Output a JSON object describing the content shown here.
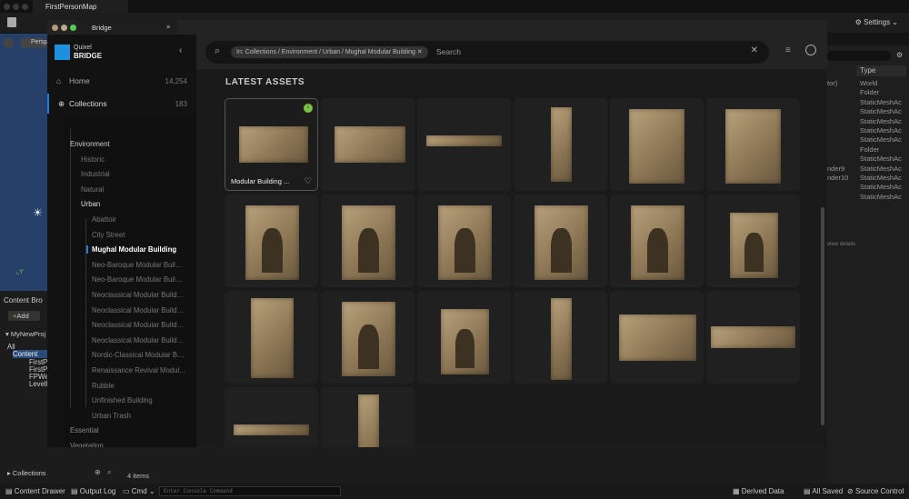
{
  "app": {
    "tab_title": "FirstPersonMap",
    "settings_label": "Settings",
    "viewport_label": "Persp"
  },
  "content_browser": {
    "title": "Content Bro",
    "add_label": "Add",
    "project": "MyNewProj",
    "tree": [
      "All",
      "Content",
      "FirstP",
      "FirstP",
      "FPWe",
      "LevelI"
    ],
    "collections_label": "Collections",
    "items_count": "4 items"
  },
  "statusbar": {
    "content_drawer": "Content Drawer",
    "output_log": "Output Log",
    "cmd": "Cmd",
    "console_placeholder": "Enter Console Command",
    "derived_data": "Derived Data",
    "all_saved": "All Saved",
    "source_control": "Source Control"
  },
  "outliner": {
    "type_header": "Type",
    "partial_names": [
      "tor)",
      "",
      "",
      "",
      "",
      "",
      "",
      "",
      "",
      "nder9",
      "nder10",
      ""
    ],
    "types": [
      "World",
      "Folder",
      "StaticMeshAc",
      "StaticMeshAc",
      "StaticMeshAc",
      "StaticMeshAc",
      "StaticMeshAc",
      "Folder",
      "StaticMeshAc",
      "StaticMeshAc",
      "StaticMeshAc",
      "StaticMeshAc",
      "StaticMeshAc"
    ],
    "details_hint": "view details."
  },
  "bridge": {
    "window_title": "Bridge",
    "logo_top": "Quixel",
    "logo_bottom": "BRIDGE",
    "nav": [
      {
        "label": "Home",
        "count": "14,254"
      },
      {
        "label": "Collections",
        "count": "183"
      }
    ],
    "tree": {
      "environment": "Environment",
      "env_children": [
        "Historic",
        "Industrial",
        "Natural",
        "Urban"
      ],
      "urban_children": [
        "Abattoir",
        "City Street",
        "Mughal Modular Building",
        "Neo-Baroque Modular Buil…",
        "Neo-Baroque Modular Buil…",
        "Neoclassical Modular Build…",
        "Neoclassical Modular Build…",
        "Neoclassical Modular Build…",
        "Neoclassical Modular Build…",
        "Nordic-Classical Modular B…",
        "Renaissance Revival Modul…",
        "Rubble",
        "Unfinished Building",
        "Urban Trash"
      ],
      "after": [
        "Essential",
        "Vegetation"
      ]
    },
    "search": {
      "filter_chip": "In: Collections / Environment / Urban / Mughal Modular Building",
      "placeholder": "Search"
    },
    "section_title": "LATEST ASSETS",
    "first_asset_name": "Modular Building ...",
    "assets": [
      "wall",
      "wall",
      "beam",
      "pillar",
      "pillars",
      "pillars",
      "door",
      "door",
      "door",
      "door",
      "door",
      "window",
      "panel",
      "door",
      "window",
      "column",
      "arches",
      "arch-wide",
      "beam",
      "column"
    ],
    "colors": {
      "accent": "#1e7be0",
      "download": "#7ac143"
    }
  }
}
